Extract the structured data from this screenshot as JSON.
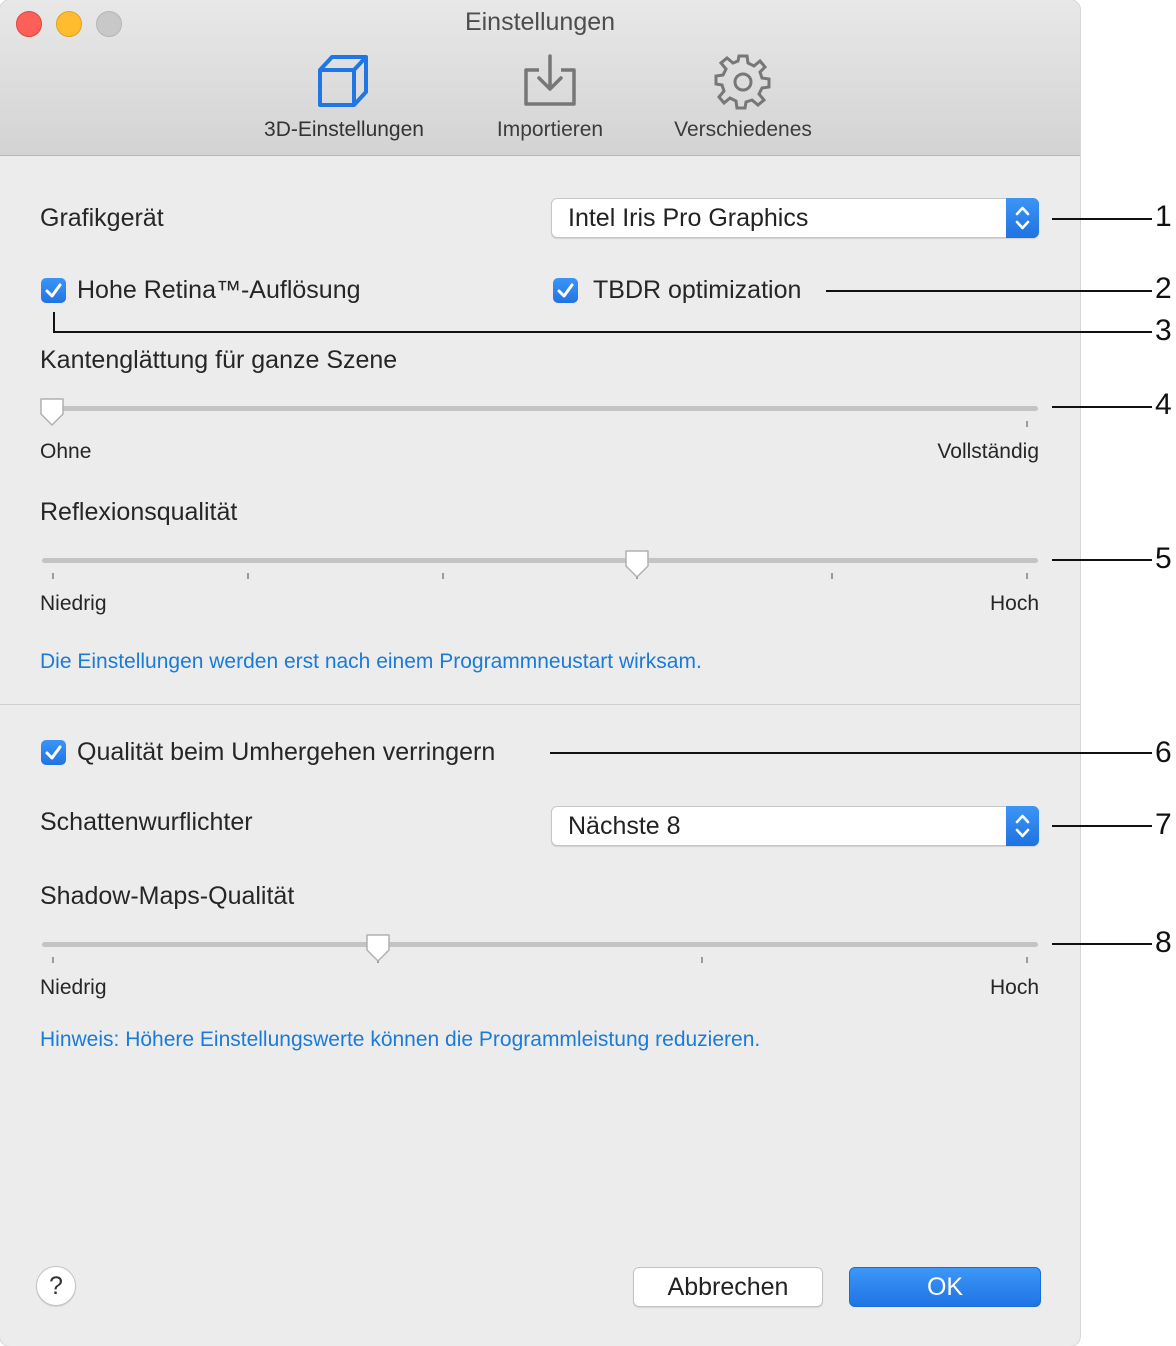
{
  "window": {
    "title": "Einstellungen"
  },
  "toolbar": {
    "tabs": [
      {
        "label": "3D-Einstellungen",
        "icon": "cube-icon",
        "active": true
      },
      {
        "label": "Importieren",
        "icon": "import-tray-icon",
        "active": false
      },
      {
        "label": "Verschiedenes",
        "icon": "gear-icon",
        "active": false
      }
    ]
  },
  "graphics_device": {
    "label": "Grafikgerät",
    "value": "Intel Iris Pro Graphics"
  },
  "retina": {
    "label": "Hohe Retina™-Auflösung",
    "checked": true
  },
  "tbdr": {
    "label": "TBDR optimization",
    "checked": true
  },
  "antialiasing": {
    "label": "Kantenglättung für ganze Szene",
    "min_label": "Ohne",
    "max_label": "Vollständig",
    "value": 0.0
  },
  "reflection": {
    "label": "Reflexionsqualität",
    "min_label": "Niedrig",
    "max_label": "Hoch",
    "value": 0.6
  },
  "restart_note": "Die Einstellungen werden erst nach einem Programmneustart wirksam.",
  "reduce_quality": {
    "label": "Qualität beim Umhergehen verringern",
    "checked": true
  },
  "shadow_lights": {
    "label": "Schattenwurflichter",
    "value": "Nächste 8"
  },
  "shadow_maps": {
    "label": "Shadow-Maps-Qualität",
    "min_label": "Niedrig",
    "max_label": "Hoch",
    "value": 0.34
  },
  "performance_note": "Hinweis: Höhere Einstellungswerte können die Programmleistung reduzieren.",
  "buttons": {
    "help": "?",
    "cancel": "Abbrechen",
    "ok": "OK"
  },
  "callouts": [
    "1",
    "2",
    "3",
    "4",
    "5",
    "6",
    "7",
    "8"
  ],
  "colors": {
    "accent": "#2176e6",
    "note": "#1a7bd8"
  }
}
